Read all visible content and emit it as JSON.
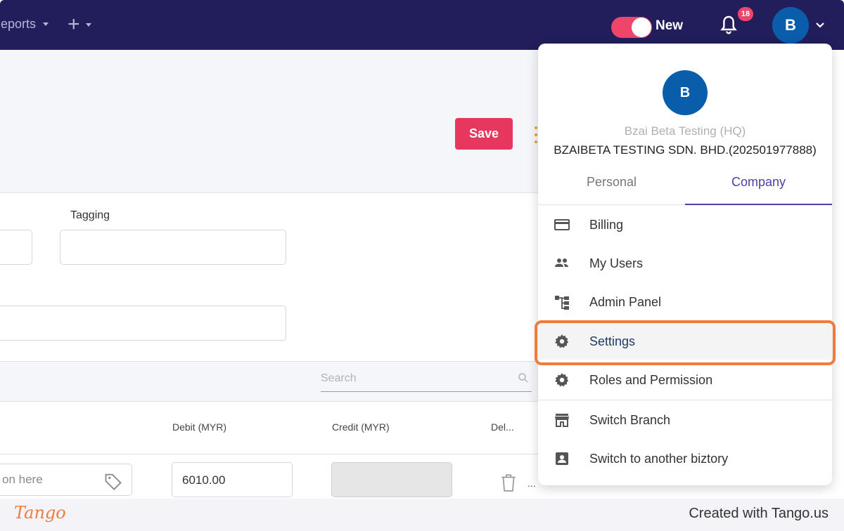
{
  "topbar": {
    "reports_label": "Reports",
    "toggle_label": "New",
    "notification_count": "18",
    "user_initial": "B"
  },
  "header": {
    "save_label": "Save"
  },
  "form": {
    "tagging_label": "Tagging"
  },
  "table": {
    "search_placeholder": "Search",
    "columns": [
      "Debit (MYR)",
      "Credit (MYR)",
      "Del..."
    ],
    "row": {
      "description_placeholder": "on here",
      "debit": "6010.00",
      "credit": "",
      "more": "..."
    }
  },
  "dropdown": {
    "avatar_initial": "B",
    "branch": "Bzai Beta Testing (HQ)",
    "company": "BZAIBETA TESTING SDN. BHD.(202501977888)",
    "tabs": [
      "Personal",
      "Company"
    ],
    "active_tab": "Company",
    "items": [
      {
        "label": "Billing",
        "icon": "credit-card-icon"
      },
      {
        "label": "My Users",
        "icon": "users-icon"
      },
      {
        "label": "Admin Panel",
        "icon": "hierarchy-icon"
      },
      {
        "label": "Settings",
        "icon": "gear-icon"
      },
      {
        "label": "Roles and Permission",
        "icon": "gear-icon"
      },
      {
        "label": "Switch Branch",
        "icon": "store-icon"
      },
      {
        "label": "Switch to another biztory",
        "icon": "account-box-icon"
      }
    ],
    "highlighted_item": "Settings"
  },
  "footer": {
    "logo": "Tango",
    "credit": "Created with Tango.us"
  },
  "colors": {
    "nav_bg": "#221e5b",
    "accent": "#e8375f",
    "avatar": "#0a5dab",
    "tab_active": "#4b3fa6",
    "highlight": "#f07c3c"
  }
}
